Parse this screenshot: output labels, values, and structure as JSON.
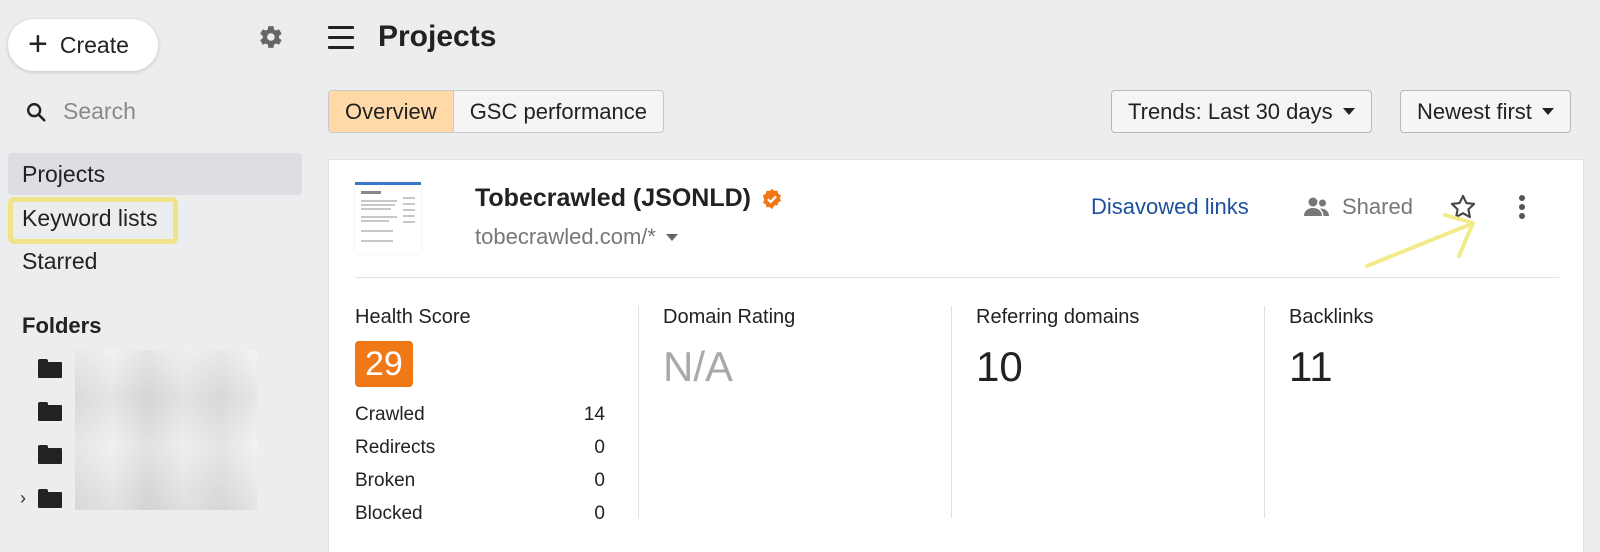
{
  "sidebar": {
    "create_label": "Create",
    "search_placeholder": "Search",
    "nav": [
      "Projects",
      "Keyword lists",
      "Starred"
    ],
    "folders_title": "Folders"
  },
  "header": {
    "title": "Projects",
    "tabs": [
      "Overview",
      "GSC performance"
    ],
    "trends_label": "Trends: Last 30 days",
    "sort_label": "Newest first"
  },
  "project": {
    "name": "Tobecrawled (JSONLD)",
    "url": "tobecrawled.com/*",
    "disavow_label": "Disavowed links",
    "shared_label": "Shared",
    "metrics": {
      "health_label": "Health Score",
      "health_value": "29",
      "dr_label": "Domain Rating",
      "dr_value": "N/A",
      "rd_label": "Referring domains",
      "rd_value": "10",
      "bl_label": "Backlinks",
      "bl_value": "11"
    },
    "stats": [
      {
        "label": "Crawled",
        "value": "14"
      },
      {
        "label": "Redirects",
        "value": "0"
      },
      {
        "label": "Broken",
        "value": "0"
      },
      {
        "label": "Blocked",
        "value": "0"
      }
    ]
  },
  "colors": {
    "accent": "#f07817",
    "tab_active": "#ffd9a8",
    "link": "#1d4f9c",
    "highlight": "#f0e48a"
  }
}
